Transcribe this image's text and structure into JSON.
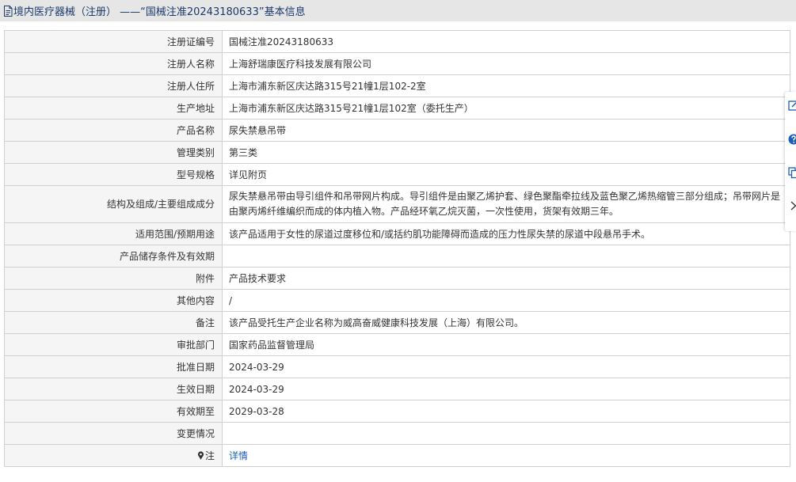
{
  "header": {
    "title": "境内医疗器械（注册） ——“国械注准20243180633”基本信息"
  },
  "rows": [
    {
      "label": "注册证编号",
      "value": "国械注准20243180633"
    },
    {
      "label": "注册人名称",
      "value": "上海舒瑞康医疗科技发展有限公司"
    },
    {
      "label": "注册人住所",
      "value": "上海市浦东新区庆达路315号21幢1层102-2室"
    },
    {
      "label": "生产地址",
      "value": "上海市浦东新区庆达路315号21幢1层102室（委托生产）"
    },
    {
      "label": "产品名称",
      "value": "尿失禁悬吊带"
    },
    {
      "label": "管理类别",
      "value": "第三类"
    },
    {
      "label": "型号规格",
      "value": "详见附页"
    },
    {
      "label": "结构及组成/主要组成成分",
      "value": "尿失禁悬吊带由导引组件和吊带网片构成。导引组件是由聚乙烯护套、绿色聚酯牵拉线及蓝色聚乙烯热缩管三部分组成；吊带网片是由聚丙烯纤维编织而成的体内植入物。产品经环氧乙烷灭菌，一次性使用，货架有效期三年。"
    },
    {
      "label": "适用范围/预期用途",
      "value": "该产品适用于女性的尿道过度移位和/或括约肌功能障碍而造成的压力性尿失禁的尿道中段悬吊手术。"
    },
    {
      "label": "产品储存条件及有效期",
      "value": ""
    },
    {
      "label": "附件",
      "value": "产品技术要求"
    },
    {
      "label": "其他内容",
      "value": "/"
    },
    {
      "label": "备注",
      "value": "该产品受托生产企业名称为威高奋威健康科技发展（上海）有限公司。"
    },
    {
      "label": "审批部门",
      "value": "国家药品监督管理局"
    },
    {
      "label": "批准日期",
      "value": "2024-03-29"
    },
    {
      "label": "生效日期",
      "value": "2024-03-29"
    },
    {
      "label": "有效期至",
      "value": "2029-03-28"
    },
    {
      "label": "变更情况",
      "value": ""
    },
    {
      "label": "注",
      "value": "详情"
    }
  ],
  "icons": {
    "title": "document-icon",
    "note": "pin-icon",
    "side": [
      "edit-icon",
      "help-icon",
      "copy-icon",
      "chevron-right-icon"
    ]
  },
  "colors": {
    "title_text": "#1a3a6b",
    "link": "#1a5fb4",
    "label_bg": "#f5f5f5"
  }
}
